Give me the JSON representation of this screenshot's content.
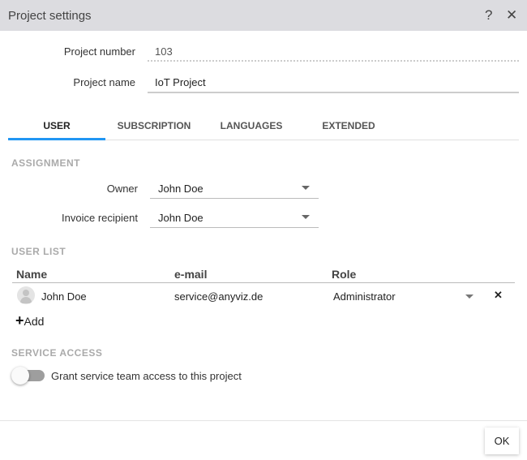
{
  "title": "Project settings",
  "fields": {
    "number_label": "Project number",
    "number_value": "103",
    "name_label": "Project name",
    "name_value": "IoT Project"
  },
  "tabs": [
    "USER",
    "SUBSCRIPTION",
    "LANGUAGES",
    "EXTENDED"
  ],
  "assignment": {
    "heading": "ASSIGNMENT",
    "owner_label": "Owner",
    "owner_value": "John Doe",
    "invoice_label": "Invoice recipient",
    "invoice_value": "John Doe"
  },
  "user_list": {
    "heading": "USER LIST",
    "columns": [
      "Name",
      "e-mail",
      "Role"
    ],
    "rows": [
      {
        "name": "John Doe",
        "email": "service@anyviz.de",
        "role": "Administrator"
      }
    ],
    "add_label": "Add"
  },
  "service": {
    "heading": "SERVICE ACCESS",
    "toggle_label": "Grant service team access to this project",
    "enabled": false
  },
  "ok_label": "OK",
  "colors": {
    "accent": "#2196f3",
    "titlebar": "#dcdce0"
  }
}
